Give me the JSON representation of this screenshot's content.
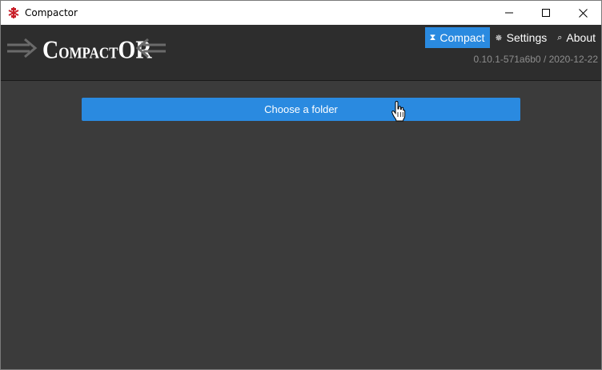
{
  "window": {
    "title": "Compactor",
    "icon": "compactor-logo-icon"
  },
  "header": {
    "logo": {
      "parts": [
        "C",
        "OMPACT",
        "O",
        "R"
      ]
    },
    "version": "0.10.1-571a6b0 / 2020-12-22",
    "nav": [
      {
        "label": "Compact",
        "glyph": "⧗",
        "icon": "hourglass-icon",
        "active": true
      },
      {
        "label": "Settings",
        "glyph": "✵",
        "icon": "gear-icon",
        "active": false
      },
      {
        "label": "About",
        "glyph": "⌕",
        "icon": "search-icon",
        "active": false
      }
    ]
  },
  "main": {
    "choose_label": "Choose a folder"
  },
  "colors": {
    "accent": "#2a8ae0",
    "header_bg": "#2d2d2d",
    "body_bg": "#3b3b3b"
  }
}
